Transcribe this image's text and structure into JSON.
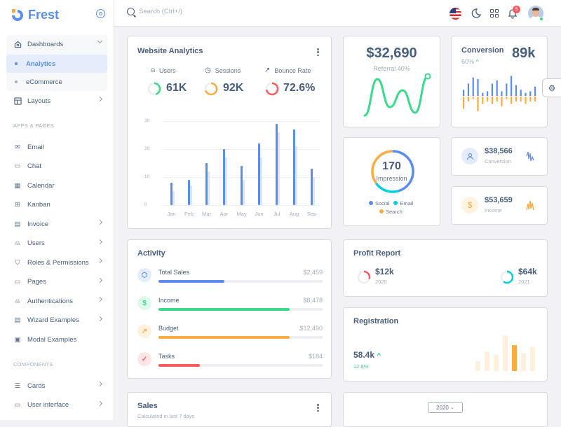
{
  "brand": {
    "name": "Frest",
    "accent": "#5a8dee"
  },
  "sidebar": {
    "dashboards": {
      "label": "Dashboards",
      "children": [
        {
          "label": "Analytics",
          "active": true
        },
        {
          "label": "eCommerce",
          "active": false
        }
      ]
    },
    "layouts": "Layouts",
    "section_apps": "APPS & PAGES",
    "apps": [
      {
        "label": "Email",
        "icon": "mail-icon",
        "chevron": false
      },
      {
        "label": "Chat",
        "icon": "chat-icon",
        "chevron": false
      },
      {
        "label": "Calendar",
        "icon": "calendar-icon",
        "chevron": false
      },
      {
        "label": "Kanban",
        "icon": "kanban-icon",
        "chevron": false
      },
      {
        "label": "Invoice",
        "icon": "invoice-icon",
        "chevron": true
      },
      {
        "label": "Users",
        "icon": "user-icon",
        "chevron": true
      },
      {
        "label": "Roles & Permissions",
        "icon": "shield-icon",
        "chevron": true
      },
      {
        "label": "Pages",
        "icon": "pages-icon",
        "chevron": true
      },
      {
        "label": "Authentications",
        "icon": "user-check-icon",
        "chevron": true
      },
      {
        "label": "Wizard Examples",
        "icon": "wizard-icon",
        "chevron": true
      },
      {
        "label": "Modal Examples",
        "icon": "modal-icon",
        "chevron": false
      }
    ],
    "section_components": "COMPONENTS",
    "components": [
      {
        "label": "Cards",
        "icon": "cards-icon",
        "chevron": true
      },
      {
        "label": "User interface",
        "icon": "ui-icon",
        "chevron": true
      }
    ]
  },
  "topbar": {
    "search_placeholder": "Search (Ctrl+/)",
    "notifications": "5"
  },
  "website_analytics": {
    "title": "Website Analytics",
    "metrics": [
      {
        "label": "Users",
        "value": "61K",
        "color": "#39da8a",
        "progress": 0.45
      },
      {
        "label": "Sessions",
        "value": "92K",
        "color": "#fdac41",
        "progress": 0.7
      },
      {
        "label": "Bounce Rate",
        "value": "72.6%",
        "color": "#ff5b5c",
        "progress": 0.72
      }
    ]
  },
  "chart_data": [
    {
      "type": "bar",
      "title": "Website Analytics",
      "categories": [
        "Jan",
        "Feb",
        "Mar",
        "Apr",
        "May",
        "Jun",
        "Jul",
        "Aug",
        "Sep"
      ],
      "series": [
        {
          "name": "primary",
          "color": "#5a8dee",
          "values": [
            8,
            9,
            15,
            20,
            14,
            22,
            29,
            27,
            13
          ]
        },
        {
          "name": "secondary",
          "color": "#dde7fb",
          "values": [
            5,
            7,
            12,
            17,
            9,
            17,
            26,
            21,
            10
          ]
        }
      ],
      "yticks": [
        0,
        10,
        20,
        30
      ],
      "ylim": [
        0,
        30
      ],
      "grid": true
    },
    {
      "type": "bar",
      "title": "Conversion",
      "series": [
        {
          "name": "up",
          "color": "#5a8dee",
          "values": [
            4,
            8,
            12,
            11,
            2,
            3,
            8,
            10,
            3,
            8,
            13,
            7,
            4,
            2,
            3,
            6
          ]
        },
        {
          "name": "down",
          "color": "#fdac41",
          "values": [
            -5,
            -2,
            -1,
            -6,
            -3,
            -2,
            -3,
            -2,
            -4,
            -1,
            -3,
            -2,
            -2,
            -3,
            -2,
            -2
          ]
        }
      ]
    },
    {
      "type": "line",
      "title": "Referral",
      "values": [
        5,
        70,
        20,
        50,
        10,
        75
      ]
    },
    {
      "type": "pie",
      "title": "Impression",
      "categories": [
        "Social",
        "Email",
        "Search"
      ],
      "values": [
        45,
        20,
        35
      ],
      "colors": [
        "#5a8dee",
        "#00cfdd",
        "#fdac41"
      ]
    },
    {
      "type": "bar",
      "title": "Registration",
      "values": [
        3,
        6,
        5,
        11,
        8,
        5.5,
        7.5
      ],
      "highlight_index": 4
    }
  ],
  "referral": {
    "value": "$32,690",
    "label": "Referral 40%"
  },
  "conversion": {
    "title": "Conversion",
    "value": "89k",
    "sub": "60%"
  },
  "impression": {
    "value": "170",
    "label": "Impression",
    "legend": [
      "Social",
      "Email",
      "Search"
    ]
  },
  "stat_conversion": {
    "value": "$38,566",
    "label": "Conversion"
  },
  "stat_income": {
    "value": "$53,659",
    "label": "Income"
  },
  "activity": {
    "title": "Activity",
    "items": [
      {
        "label": "Total Sales",
        "value": "$2,459",
        "progress": 0.4,
        "color": "#5a8dee",
        "bg": "#e5edfc",
        "glyph": "⬡"
      },
      {
        "label": "Income",
        "value": "$8,478",
        "progress": 0.8,
        "color": "#39da8a",
        "bg": "#dff9ec",
        "glyph": "$"
      },
      {
        "label": "Budget",
        "value": "$12,490",
        "progress": 0.8,
        "color": "#fdac41",
        "bg": "#fff2e1",
        "glyph": "↗"
      },
      {
        "label": "Tasks",
        "value": "$184",
        "progress": 0.25,
        "color": "#ff5b5c",
        "bg": "#ffe5e5",
        "glyph": "✓"
      }
    ]
  },
  "profit": {
    "title": "Profit Report",
    "items": [
      {
        "value": "$12k",
        "year": "2020",
        "color": "#ff5b5c",
        "progress": 0.3
      },
      {
        "value": "$64k",
        "year": "2021",
        "color": "#00cfdd",
        "progress": 0.6
      }
    ]
  },
  "registration": {
    "title": "Registration",
    "value": "58.4k",
    "change": "12.8%"
  },
  "sales": {
    "title": "Sales",
    "subtitle": "Calculated in last 7 days"
  },
  "year_select": {
    "value": "2020"
  }
}
